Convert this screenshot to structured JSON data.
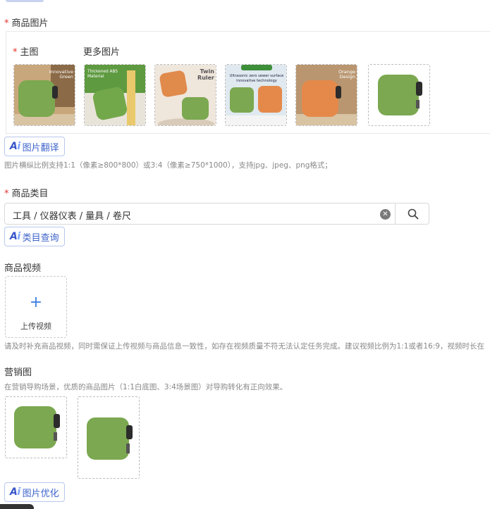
{
  "product_images": {
    "label": "商品图片",
    "main_label": "主图",
    "more_label": "更多图片",
    "thumbs": [
      {
        "name": "main-image",
        "caption_lines": [
          "Innovative",
          "Green"
        ],
        "product_color": "#7ba850",
        "bg": "#c9a77c"
      },
      {
        "name": "more-image-1",
        "caption_lines": [
          "Thickened ABS",
          "Material"
        ],
        "product_color": "#72a84a",
        "bg": "#5e9a40"
      },
      {
        "name": "more-image-2",
        "caption_lines": [
          "Twin",
          "Ruler"
        ],
        "product_color": "#e08a4c",
        "bg": "#efe6dc"
      },
      {
        "name": "more-image-3",
        "caption_lines": [
          "Ultrasonic zero sewer surface",
          "innovative technology"
        ],
        "product_color": "#7ba850",
        "bg": "#dfe9ef"
      },
      {
        "name": "more-image-4",
        "caption_lines": [
          "Orange",
          "Design"
        ],
        "product_color": "#e5894a",
        "bg": "#b99670"
      },
      {
        "name": "more-image-5",
        "caption_lines": [],
        "product_color": "#7ba850",
        "bg": "#ffffff"
      }
    ],
    "ai_button": "图片翻译",
    "hint": "图片横纵比例支持1:1（像素≥800*800）或3:4（像素≥750*1000），支持jpg、jpeg、png格式；"
  },
  "category": {
    "label": "商品类目",
    "value": "工具 / 仪器仪表 / 量具 / 卷尺",
    "ai_button": "类目查询"
  },
  "video": {
    "label": "商品视频",
    "upload_label": "上传视频",
    "hint": "请及时补充商品视频，同时需保证上传视频与商品信息一致性，如存在视频质量不符无法认定任务完成。建议视频比例为1:1或者16:9，视频时长在"
  },
  "marketing": {
    "label": "营销图",
    "hint": "在营销导购场景，优质的商品图片（1:1白底图、3:4场景图）对导购转化有正向效果。",
    "ai_button": "图片优化"
  },
  "ai_prefix": "Ai",
  "icons": {
    "search": "search-icon",
    "clear": "clear-icon",
    "plus": "plus-icon"
  },
  "colors": {
    "accent": "#3f64cc",
    "required": "#e5322d"
  }
}
